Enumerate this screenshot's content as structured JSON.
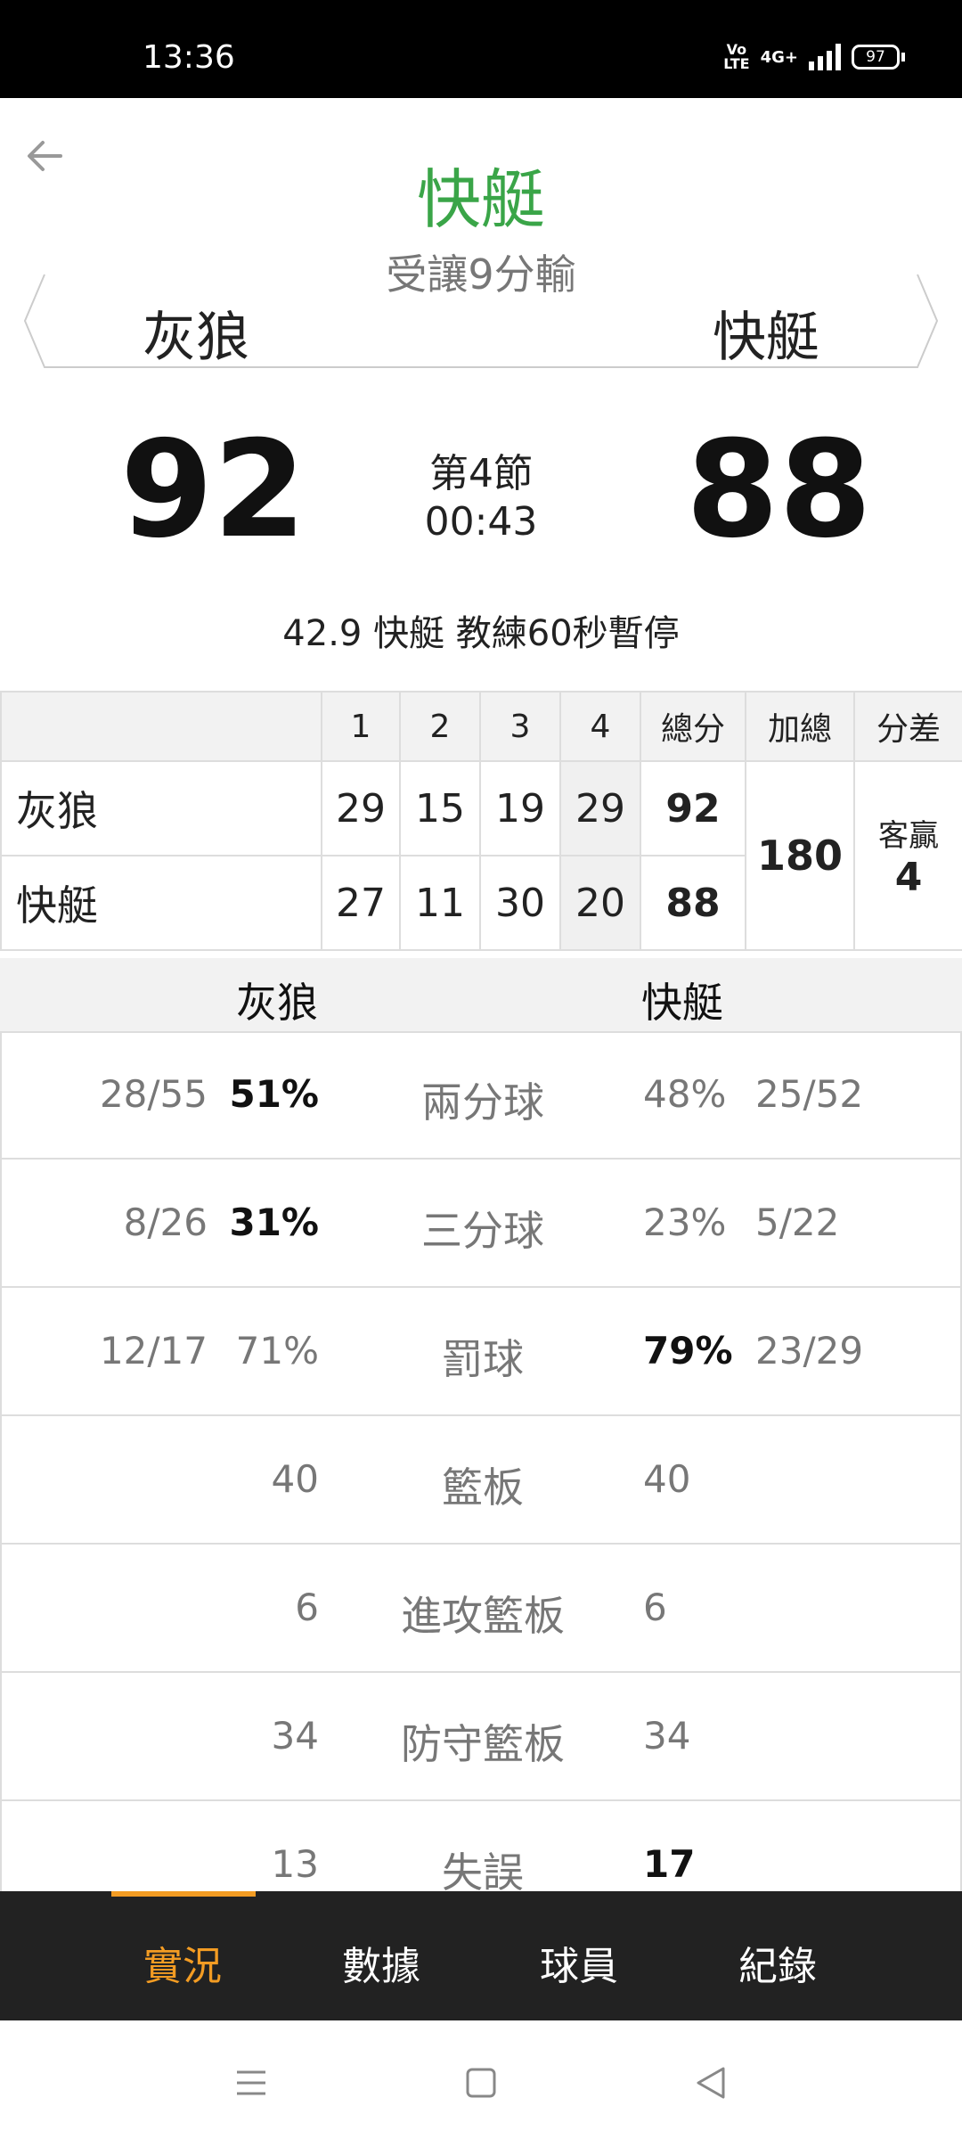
{
  "status_bar": {
    "time": "13:36",
    "volte": "Vo\nLTE",
    "network": "4G+",
    "battery": "97"
  },
  "header": {
    "favorite_team": "快艇",
    "handicap_result": "受讓9分輸",
    "away_team": "灰狼",
    "home_team": "快艇"
  },
  "scoreboard": {
    "away_score": "92",
    "home_score": "88",
    "period": "第4節",
    "clock": "00:43",
    "last_event": "42.9 快艇  教練60秒暫停"
  },
  "quarters": {
    "headers": [
      "1",
      "2",
      "3",
      "4",
      "總分",
      "加總",
      "分差"
    ],
    "rows": [
      {
        "team": "灰狼",
        "q": [
          "29",
          "15",
          "19",
          "29"
        ],
        "total": "92"
      },
      {
        "team": "快艇",
        "q": [
          "27",
          "11",
          "30",
          "20"
        ],
        "total": "88"
      }
    ],
    "combined": "180",
    "diff_label": "客贏",
    "diff_value": "4"
  },
  "stats": {
    "away_team": "灰狼",
    "home_team": "快艇",
    "rows": [
      {
        "label": "兩分球",
        "away_frac": "28/55",
        "away_val": "51%",
        "home_val": "48%",
        "home_frac": "25/52",
        "leader": "away"
      },
      {
        "label": "三分球",
        "away_frac": "8/26",
        "away_val": "31%",
        "home_val": "23%",
        "home_frac": "5/22",
        "leader": "away"
      },
      {
        "label": "罰球",
        "away_frac": "12/17",
        "away_val": "71%",
        "home_val": "79%",
        "home_frac": "23/29",
        "leader": "home"
      },
      {
        "label": "籃板",
        "away_frac": "",
        "away_val": "40",
        "home_val": "40",
        "home_frac": "",
        "leader": "none"
      },
      {
        "label": "進攻籃板",
        "away_frac": "",
        "away_val": "6",
        "home_val": "6",
        "home_frac": "",
        "leader": "none"
      },
      {
        "label": "防守籃板",
        "away_frac": "",
        "away_val": "34",
        "home_val": "34",
        "home_frac": "",
        "leader": "none"
      },
      {
        "label": "失誤",
        "away_frac": "",
        "away_val": "13",
        "home_val": "17",
        "home_frac": "",
        "leader": "home"
      }
    ]
  },
  "bottom_nav": {
    "items": [
      "實況",
      "數據",
      "球員",
      "紀錄"
    ],
    "active": 0
  },
  "colors": {
    "accent": "#f39c23",
    "favorite": "#3aa548",
    "nav_bg": "#222222"
  },
  "icons": {
    "back": "arrow-left-icon",
    "menu": "menu-icon",
    "home": "home-icon",
    "back_nav": "triangle-back-icon"
  }
}
